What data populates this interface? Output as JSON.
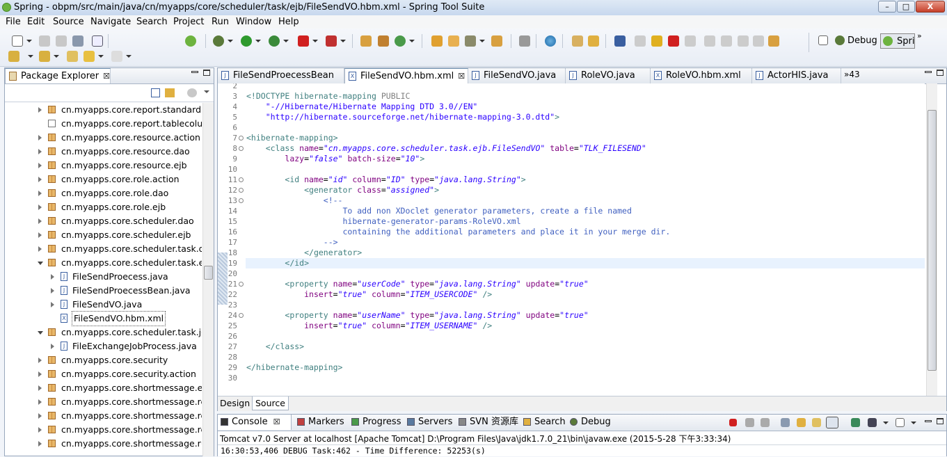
{
  "window": {
    "title": "Spring - obpm/src/main/java/cn/myapps/core/scheduler/task/ejb/FileSendVO.hbm.xml - Spring Tool Suite",
    "minimize": "–",
    "maximize": "□",
    "close": "X"
  },
  "menu": [
    "File",
    "Edit",
    "Source",
    "Navigate",
    "Search",
    "Project",
    "Run",
    "Window",
    "Help"
  ],
  "perspectives": {
    "debug": "Debug",
    "spring": "Spri",
    "more": "»"
  },
  "package_explorer": {
    "title": "Package Explorer",
    "items": [
      {
        "label": "cn.myapps.core.report.standardrep",
        "indent": 0,
        "twisty": "closed",
        "icon": "package-icon"
      },
      {
        "label": "cn.myapps.core.report.tablecolumn",
        "indent": 0,
        "twisty": "none",
        "icon": "empty-package-icon"
      },
      {
        "label": "cn.myapps.core.resource.action",
        "indent": 0,
        "twisty": "closed",
        "icon": "package-icon"
      },
      {
        "label": "cn.myapps.core.resource.dao",
        "indent": 0,
        "twisty": "closed",
        "icon": "package-icon"
      },
      {
        "label": "cn.myapps.core.resource.ejb",
        "indent": 0,
        "twisty": "closed",
        "icon": "package-icon"
      },
      {
        "label": "cn.myapps.core.role.action",
        "indent": 0,
        "twisty": "closed",
        "icon": "package-icon"
      },
      {
        "label": "cn.myapps.core.role.dao",
        "indent": 0,
        "twisty": "closed",
        "icon": "package-icon"
      },
      {
        "label": "cn.myapps.core.role.ejb",
        "indent": 0,
        "twisty": "closed",
        "icon": "package-icon"
      },
      {
        "label": "cn.myapps.core.scheduler.dao",
        "indent": 0,
        "twisty": "closed",
        "icon": "package-icon"
      },
      {
        "label": "cn.myapps.core.scheduler.ejb",
        "indent": 0,
        "twisty": "closed",
        "icon": "package-icon"
      },
      {
        "label": "cn.myapps.core.scheduler.task.dao",
        "indent": 0,
        "twisty": "closed",
        "icon": "package-icon"
      },
      {
        "label": "cn.myapps.core.scheduler.task.ejb",
        "indent": 0,
        "twisty": "open",
        "icon": "package-icon"
      },
      {
        "label": "FileSendProecess.java",
        "indent": 1,
        "twisty": "closed",
        "icon": "java-file-icon"
      },
      {
        "label": "FileSendProecessBean.java",
        "indent": 1,
        "twisty": "closed",
        "icon": "java-file-icon"
      },
      {
        "label": "FileSendVO.java",
        "indent": 1,
        "twisty": "closed",
        "icon": "java-file-icon"
      },
      {
        "label": "FileSendVO.hbm.xml",
        "indent": 1,
        "twisty": "none",
        "icon": "xml-file-icon",
        "selected": true
      },
      {
        "label": "cn.myapps.core.scheduler.task.job",
        "indent": 0,
        "twisty": "open",
        "icon": "package-icon"
      },
      {
        "label": "FileExchangeJobProcess.java",
        "indent": 1,
        "twisty": "closed",
        "icon": "java-file-icon"
      },
      {
        "label": "cn.myapps.core.security",
        "indent": 0,
        "twisty": "closed",
        "icon": "package-icon"
      },
      {
        "label": "cn.myapps.core.security.action",
        "indent": 0,
        "twisty": "closed",
        "icon": "package-icon"
      },
      {
        "label": "cn.myapps.core.shortmessage.exce",
        "indent": 0,
        "twisty": "closed",
        "icon": "package-icon"
      },
      {
        "label": "cn.myapps.core.shortmessage.rece",
        "indent": 0,
        "twisty": "closed",
        "icon": "package-icon"
      },
      {
        "label": "cn.myapps.core.shortmessage.rece",
        "indent": 0,
        "twisty": "closed",
        "icon": "package-icon"
      },
      {
        "label": "cn.myapps.core.shortmessage.rece",
        "indent": 0,
        "twisty": "closed",
        "icon": "package-icon"
      },
      {
        "label": "cn.myapps.core.shortmessage.runt",
        "indent": 0,
        "twisty": "closed",
        "icon": "package-icon"
      }
    ]
  },
  "editor": {
    "tabs": [
      {
        "label": "FileSendProecessBean",
        "icon": "J",
        "active": false
      },
      {
        "label": "FileSendVO.hbm.xml",
        "icon": "X",
        "active": true,
        "close": "☒"
      },
      {
        "label": "FileSendVO.java",
        "icon": "J",
        "active": false
      },
      {
        "label": "RoleVO.java",
        "icon": "J",
        "active": false
      },
      {
        "label": "RoleVO.hbm.xml",
        "icon": "X",
        "active": false
      },
      {
        "label": "ActorHIS.java",
        "icon": "J",
        "active": false
      }
    ],
    "overflow": "»43",
    "bottom_tabs": [
      "Design",
      "Source"
    ],
    "lines": [
      {
        "n": "2",
        "parts": []
      },
      {
        "n": "3",
        "parts": [
          [
            "kw",
            "<!DOCTYPE hibernate-mapping "
          ],
          [
            "gray",
            "PUBLIC"
          ]
        ]
      },
      {
        "n": "4",
        "parts": [
          [
            "",
            "    "
          ],
          [
            "dt",
            "\"-//Hibernate/Hibernate Mapping DTD 3.0//EN\""
          ]
        ]
      },
      {
        "n": "5",
        "parts": [
          [
            "",
            "    "
          ],
          [
            "dt",
            "\"http://hibernate.sourceforge.net/hibernate-mapping-3.0.dtd\""
          ],
          [
            "kw",
            ">"
          ]
        ]
      },
      {
        "n": "6",
        "parts": []
      },
      {
        "n": "7",
        "fold": true,
        "parts": [
          [
            "kw",
            "<hibernate-mapping>"
          ]
        ]
      },
      {
        "n": "8",
        "fold": true,
        "parts": [
          [
            "",
            "    "
          ],
          [
            "kw",
            "<class "
          ],
          [
            "at",
            "name"
          ],
          [
            "",
            "="
          ],
          [
            "sv",
            "\"cn.myapps.core.scheduler.task.ejb.FileSendVO\""
          ],
          [
            "",
            " "
          ],
          [
            "at",
            "table"
          ],
          [
            "",
            "="
          ],
          [
            "sv",
            "\"TLK_FILESEND\""
          ]
        ]
      },
      {
        "n": "9",
        "parts": [
          [
            "",
            "        "
          ],
          [
            "at",
            "lazy"
          ],
          [
            "",
            "="
          ],
          [
            "sv",
            "\"false\""
          ],
          [
            "",
            " "
          ],
          [
            "at",
            "batch-size"
          ],
          [
            "",
            "="
          ],
          [
            "sv",
            "\"10\""
          ],
          [
            "kw",
            ">"
          ]
        ]
      },
      {
        "n": "10",
        "parts": []
      },
      {
        "n": "11",
        "fold": true,
        "parts": [
          [
            "",
            "        "
          ],
          [
            "kw",
            "<id "
          ],
          [
            "at",
            "name"
          ],
          [
            "",
            "="
          ],
          [
            "sv",
            "\"id\""
          ],
          [
            "",
            " "
          ],
          [
            "at",
            "column"
          ],
          [
            "",
            "="
          ],
          [
            "sv",
            "\"ID\""
          ],
          [
            "",
            " "
          ],
          [
            "at",
            "type"
          ],
          [
            "",
            "="
          ],
          [
            "sv",
            "\"java.lang.String\""
          ],
          [
            "kw",
            ">"
          ]
        ]
      },
      {
        "n": "12",
        "fold": true,
        "parts": [
          [
            "",
            "            "
          ],
          [
            "kw",
            "<generator "
          ],
          [
            "at",
            "class"
          ],
          [
            "",
            "="
          ],
          [
            "sv",
            "\"assigned\""
          ],
          [
            "kw",
            ">"
          ]
        ]
      },
      {
        "n": "13",
        "fold": true,
        "parts": [
          [
            "",
            "                "
          ],
          [
            "cm",
            "<!--"
          ]
        ]
      },
      {
        "n": "14",
        "parts": [
          [
            "cm",
            "                    To add non XDoclet generator parameters, create a file named"
          ]
        ]
      },
      {
        "n": "15",
        "parts": [
          [
            "cm",
            "                    hibernate-generator-params-RoleVO.xml"
          ]
        ]
      },
      {
        "n": "16",
        "parts": [
          [
            "cm",
            "                    containing the additional parameters and place it in your merge dir."
          ]
        ]
      },
      {
        "n": "17",
        "parts": [
          [
            "cm",
            "                -->"
          ]
        ]
      },
      {
        "n": "18",
        "parts": [
          [
            "",
            "            "
          ],
          [
            "kw",
            "</generator>"
          ]
        ]
      },
      {
        "n": "19",
        "highlight": true,
        "parts": [
          [
            "",
            "        "
          ],
          [
            "kw",
            "</id>"
          ]
        ]
      },
      {
        "n": "20",
        "parts": []
      },
      {
        "n": "21",
        "fold": true,
        "parts": [
          [
            "",
            "        "
          ],
          [
            "kw",
            "<property "
          ],
          [
            "at",
            "name"
          ],
          [
            "",
            "="
          ],
          [
            "sv",
            "\"userCode\""
          ],
          [
            "",
            " "
          ],
          [
            "at",
            "type"
          ],
          [
            "",
            "="
          ],
          [
            "sv",
            "\"java.lang.String\""
          ],
          [
            "",
            " "
          ],
          [
            "at",
            "update"
          ],
          [
            "",
            "="
          ],
          [
            "sv",
            "\"true\""
          ]
        ]
      },
      {
        "n": "22",
        "parts": [
          [
            "",
            "            "
          ],
          [
            "at",
            "insert"
          ],
          [
            "",
            "="
          ],
          [
            "sv",
            "\"true\""
          ],
          [
            "",
            " "
          ],
          [
            "at",
            "column"
          ],
          [
            "",
            "="
          ],
          [
            "sv",
            "\"ITEM_USERCODE\""
          ],
          [
            "",
            " "
          ],
          [
            "kw",
            "/>"
          ]
        ]
      },
      {
        "n": "23",
        "parts": []
      },
      {
        "n": "24",
        "fold": true,
        "parts": [
          [
            "",
            "        "
          ],
          [
            "kw",
            "<property "
          ],
          [
            "at",
            "name"
          ],
          [
            "",
            "="
          ],
          [
            "sv",
            "\"userName\""
          ],
          [
            "",
            " "
          ],
          [
            "at",
            "type"
          ],
          [
            "",
            "="
          ],
          [
            "sv",
            "\"java.lang.String\""
          ],
          [
            "",
            " "
          ],
          [
            "at",
            "update"
          ],
          [
            "",
            "="
          ],
          [
            "sv",
            "\"true\""
          ]
        ]
      },
      {
        "n": "25",
        "parts": [
          [
            "",
            "            "
          ],
          [
            "at",
            "insert"
          ],
          [
            "",
            "="
          ],
          [
            "sv",
            "\"true\""
          ],
          [
            "",
            " "
          ],
          [
            "at",
            "column"
          ],
          [
            "",
            "="
          ],
          [
            "sv",
            "\"ITEM_USERNAME\""
          ],
          [
            "",
            " "
          ],
          [
            "kw",
            "/>"
          ]
        ]
      },
      {
        "n": "26",
        "parts": []
      },
      {
        "n": "27",
        "parts": [
          [
            "",
            "    "
          ],
          [
            "kw",
            "</class>"
          ]
        ]
      },
      {
        "n": "28",
        "parts": []
      },
      {
        "n": "29",
        "parts": [
          [
            "kw",
            "</hibernate-mapping>"
          ]
        ]
      },
      {
        "n": "30",
        "parts": []
      }
    ]
  },
  "console": {
    "tabs": [
      "Console",
      "Markers",
      "Progress",
      "Servers",
      "SVN 资源库",
      "Search",
      "Debug"
    ],
    "header": "Tomcat v7.0 Server at localhost [Apache Tomcat] D:\\Program Files\\Java\\jdk1.7.0_21\\bin\\javaw.exe (2015-5-28 下午3:33:34)",
    "output": "16:30:53,406 DEBUG Task:462 - Time Difference: 52253(s)"
  }
}
